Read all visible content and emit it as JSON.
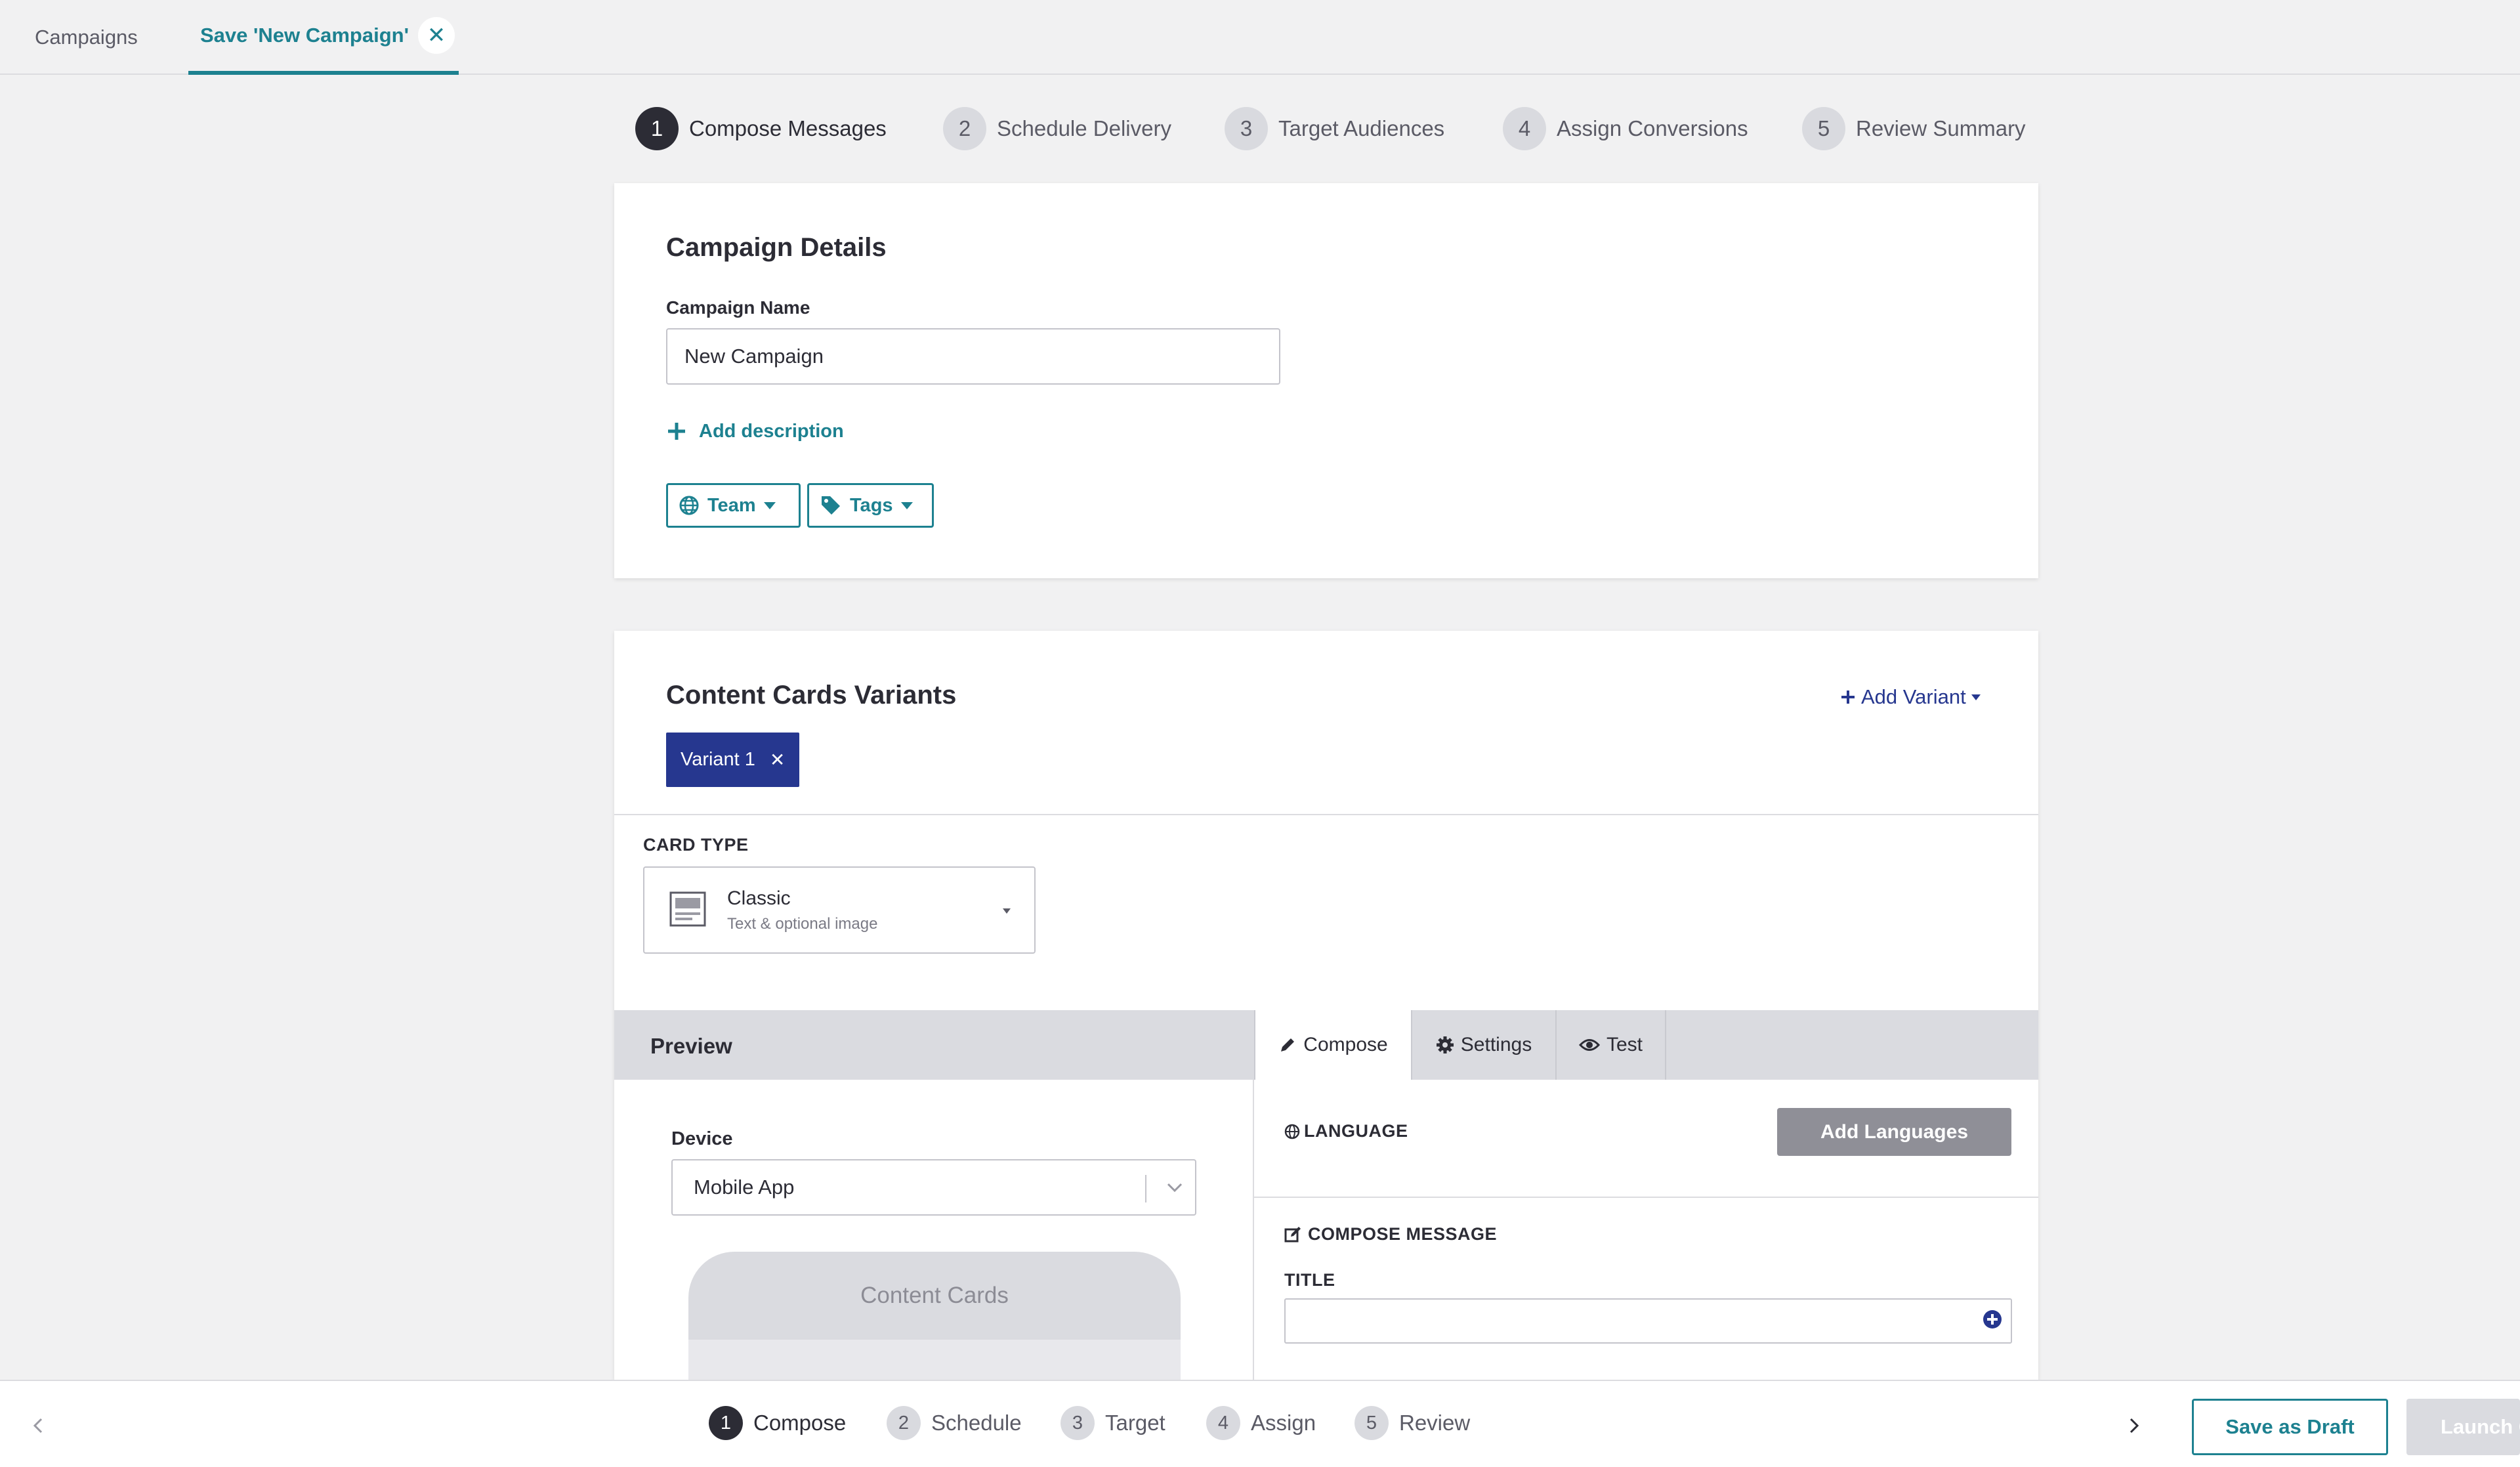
{
  "top_tabs": {
    "campaigns_label": "Campaigns",
    "active_label": "Save 'New Campaign'",
    "close_glyph": "✕"
  },
  "stepper": [
    {
      "num": "1",
      "label": "Compose Messages"
    },
    {
      "num": "2",
      "label": "Schedule Delivery"
    },
    {
      "num": "3",
      "label": "Target Audiences"
    },
    {
      "num": "4",
      "label": "Assign Conversions"
    },
    {
      "num": "5",
      "label": "Review Summary"
    }
  ],
  "details": {
    "title": "Campaign Details",
    "name_label": "Campaign Name",
    "name_value": "New Campaign",
    "add_description": "Add description",
    "team_label": "Team",
    "tags_label": "Tags"
  },
  "variants": {
    "title": "Content Cards Variants",
    "add_variant": "Add Variant",
    "variant_tab": "Variant 1",
    "close_glyph": "✕",
    "card_type_label": "CARD TYPE",
    "card_type_value": "Classic",
    "card_type_desc": "Text & optional image"
  },
  "preview": {
    "title": "Preview",
    "device_label": "Device",
    "device_value": "Mobile App",
    "phone_header": "Content Cards"
  },
  "compose": {
    "tabs": [
      "Compose",
      "Settings",
      "Test"
    ],
    "language_label": "LANGUAGE",
    "add_languages": "Add Languages",
    "compose_message_label": "COMPOSE MESSAGE",
    "title_label": "TITLE",
    "title_value": ""
  },
  "bottom": {
    "steps": [
      {
        "num": "1",
        "label": "Compose"
      },
      {
        "num": "2",
        "label": "Schedule"
      },
      {
        "num": "3",
        "label": "Target"
      },
      {
        "num": "4",
        "label": "Assign"
      },
      {
        "num": "5",
        "label": "Review"
      }
    ],
    "save_draft": "Save as Draft",
    "launch": "Launch C"
  },
  "colors": {
    "accent_teal": "#1d8190",
    "variant_navy": "#26378f",
    "background": "#f1f1f2"
  },
  "icons": [
    "close-icon",
    "plus-icon",
    "globe-icon",
    "tag-icon",
    "image-card-icon",
    "chevron-down-icon",
    "pencil-icon",
    "gear-icon",
    "eye-icon",
    "edit-square-icon",
    "add-circle-icon",
    "chevron-left-icon",
    "chevron-right-icon"
  ]
}
